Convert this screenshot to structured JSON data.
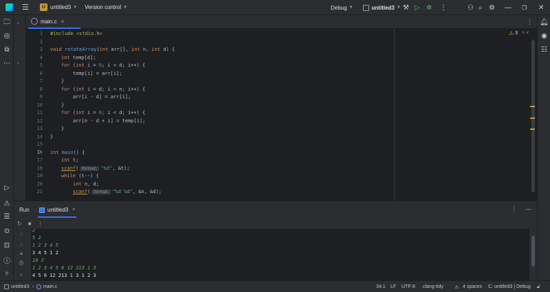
{
  "titlebar": {
    "project_badge": "U",
    "project_name": "untitled3",
    "vcs_label": "Version control",
    "run_mode": "Debug",
    "run_target": "untitled3"
  },
  "editor": {
    "tab_label": "main.c",
    "warning_count": "3",
    "lines": [
      {
        "n": "1"
      },
      {
        "n": "2"
      },
      {
        "n": "3"
      },
      {
        "n": "4"
      },
      {
        "n": "5"
      },
      {
        "n": "6"
      },
      {
        "n": "7"
      },
      {
        "n": "8"
      },
      {
        "n": "9"
      },
      {
        "n": "10"
      },
      {
        "n": "11"
      },
      {
        "n": "12"
      },
      {
        "n": "13"
      },
      {
        "n": "14"
      },
      {
        "n": "15"
      },
      {
        "n": "16"
      },
      {
        "n": "17"
      },
      {
        "n": "18"
      },
      {
        "n": "19"
      },
      {
        "n": "20"
      },
      {
        "n": "21"
      }
    ],
    "code": {
      "l1_a": "#include ",
      "l1_b": "<stdio.h>",
      "l3_kw1": "void ",
      "l3_fn": "rotateArray",
      "l3_a": "(",
      "l3_kw2": "int ",
      "l3_b": "arr[], ",
      "l3_kw3": "int ",
      "l3_c": "n, ",
      "l3_kw4": "int ",
      "l3_d": "d) {",
      "l4_kw": "int ",
      "l4_a": "temp[d];",
      "l5_kw": "for ",
      "l5_a": "(",
      "l5_kw2": "int ",
      "l5_b": "i = ",
      "l5_num": "0",
      "l5_c": "; i < d; i++) {",
      "l6": "temp[i] = arr[i];",
      "l7": "}",
      "l8_kw": "for ",
      "l8_a": "(",
      "l8_kw2": "int ",
      "l8_b": "i = d; i < n; i++) {",
      "l9": "arr[i - d] = arr[i];",
      "l10": "}",
      "l11_kw": "for ",
      "l11_a": "(",
      "l11_kw2": "int ",
      "l11_b": "i = ",
      "l11_num": "0",
      "l11_c": "; i < d; i++) {",
      "l12": "arr[n - d + i] = temp[i];",
      "l13": "}",
      "l14": "}",
      "l16_kw": "int ",
      "l16_fn": "main",
      "l16_a": "() {",
      "l17_kw": "int ",
      "l17_a": "t;",
      "l18_fn": "scanf",
      "l18_a": "(",
      "l18_hint": "format:",
      "l18_str": "\"%d\"",
      "l18_b": ", &t);",
      "l19_kw": "while ",
      "l19_a": "(t--) {",
      "l20_kw": "int ",
      "l20_a": "n, d;",
      "l21_fn": "scanf",
      "l21_a": "(",
      "l21_hint": "format:",
      "l21_str": "\"%d %d\"",
      "l21_b": ", &n, &d);"
    }
  },
  "run_panel": {
    "title": "Run",
    "tab_label": "untitled3",
    "console": [
      {
        "text": "2",
        "kind": "input"
      },
      {
        "text": "5 2",
        "kind": "input"
      },
      {
        "text": "1 2 3 4 5",
        "kind": "input"
      },
      {
        "text": "3 4 5 1 2",
        "kind": "output"
      },
      {
        "text": "10 3",
        "kind": "input"
      },
      {
        "text": "1 2 3 4 5 6 12 213 1 3",
        "kind": "input"
      },
      {
        "text": "4 5 6 12 213 1 3 1 2 3",
        "kind": "output"
      }
    ]
  },
  "statusbar": {
    "crumb_project": "untitled3",
    "crumb_file": "main.c",
    "position": "34:1",
    "line_sep": "LF",
    "encoding": "UTF-8",
    "formatter": ".clang-tidy",
    "indent": "4 spaces",
    "context": "C: untitled3 | Debug"
  }
}
